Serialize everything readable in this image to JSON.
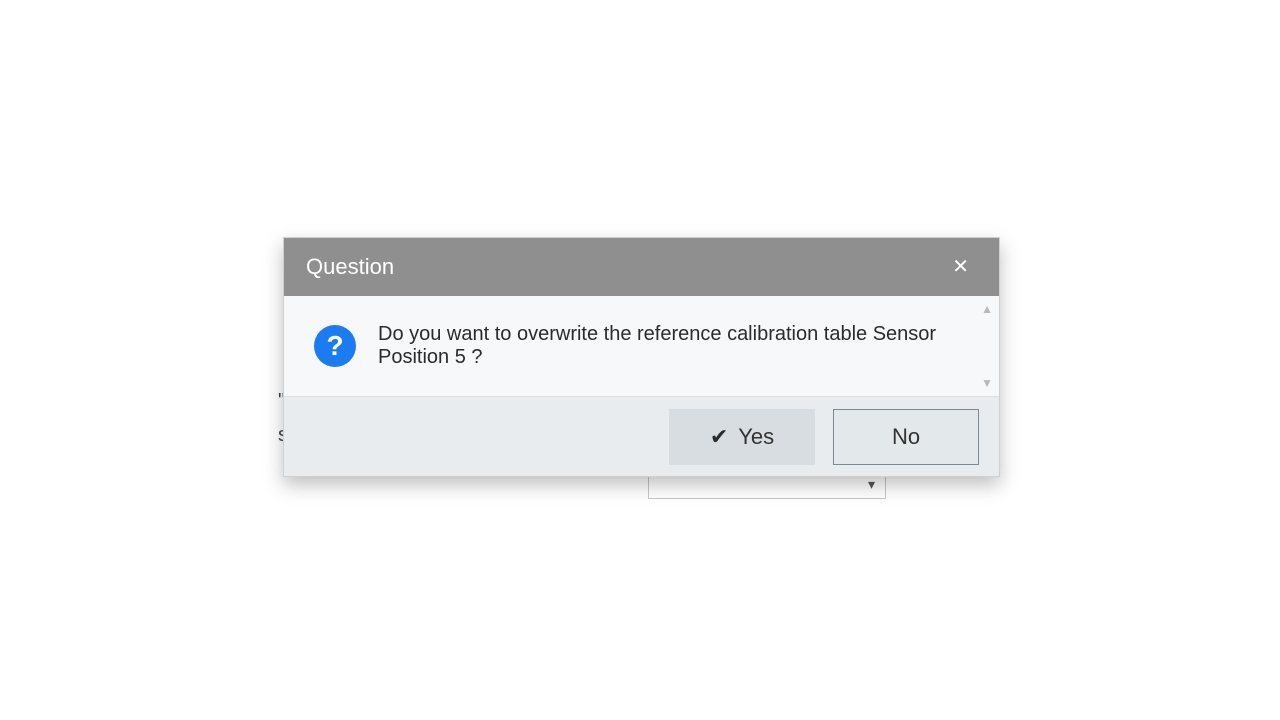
{
  "dialog": {
    "title": "Question",
    "message": "Do you want to overwrite the reference calibration table Sensor Position 5 ?",
    "icon": "?",
    "buttons": {
      "yes": "Yes",
      "no": "No"
    }
  },
  "background": {
    "frag1": "\"",
    "frag2": "s",
    "dropdown_visible_text": ""
  }
}
